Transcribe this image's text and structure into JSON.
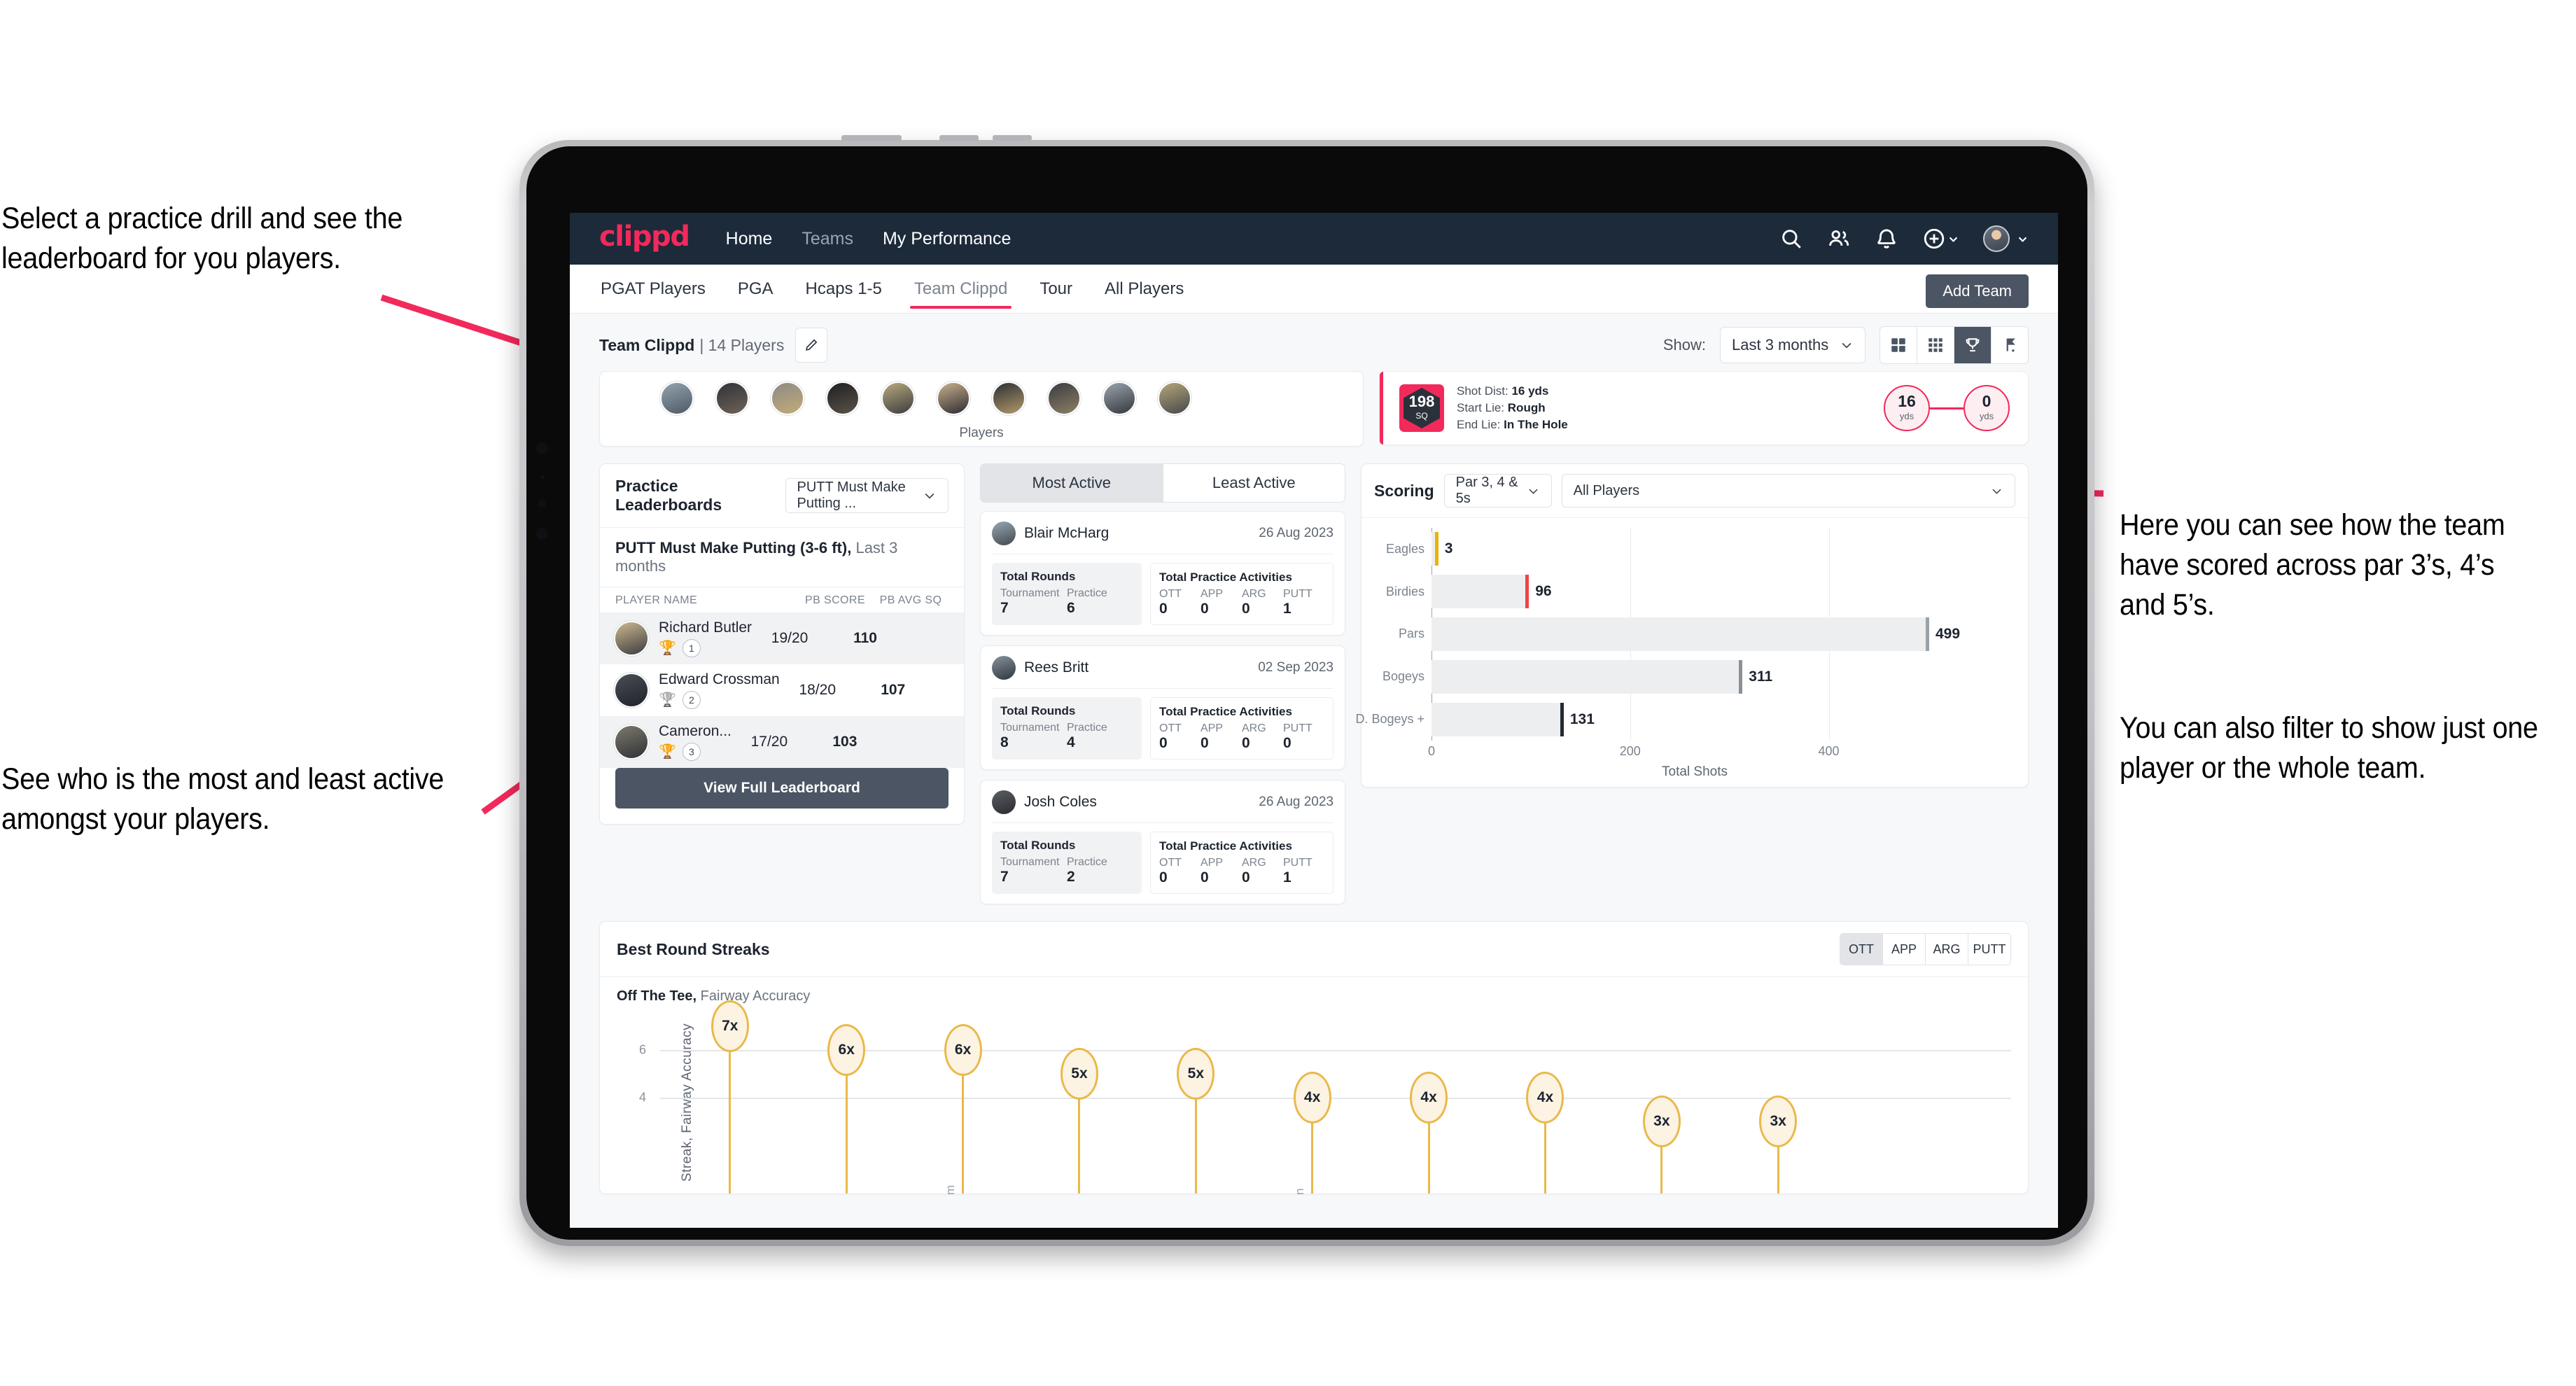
{
  "annotations": {
    "top_left": "Select a practice drill and see the leaderboard for you players.",
    "bottom_left": "See who is the most and least active amongst your players.",
    "right_1": "Here you can see how the team have scored across par 3’s, 4’s and 5’s.",
    "right_2": "You can also filter to show just one player or the whole team.",
    "accent_color": "#f2295b"
  },
  "navbar": {
    "logo": "clippd",
    "links": [
      {
        "label": "Home",
        "active": true
      },
      {
        "label": "Teams",
        "active": false
      },
      {
        "label": "My Performance",
        "active": true
      }
    ],
    "icons": [
      "search-icon",
      "people-icon",
      "bell-icon",
      "plus-circle-icon",
      "avatar"
    ],
    "brand_color": "#f2295b",
    "bg_color": "#1c2a3a"
  },
  "tabs": {
    "items": [
      "PGAT Players",
      "PGA",
      "Hcaps 1-5",
      "Team Clippd",
      "Tour",
      "All Players"
    ],
    "active": "Team Clippd",
    "add_team_label": "Add Team"
  },
  "team_header": {
    "team_name": "Team Clippd",
    "player_count_text": "| 14 Players",
    "edit_icon": "pencil-icon",
    "show_label": "Show:",
    "range_value": "Last 3 months",
    "view_modes": [
      "grid-large-icon",
      "grid-small-icon",
      "trophy-icon",
      "flag-icon"
    ],
    "view_mode_selected": "trophy-icon"
  },
  "players_strip": {
    "label": "Players",
    "avatar_count": 10
  },
  "shot_card": {
    "badge_value": "198",
    "badge_unit": "SQ",
    "lines": [
      {
        "label": "Shot Dist:",
        "value": "16 yds"
      },
      {
        "label": "Start Lie:",
        "value": "Rough"
      },
      {
        "label": "End Lie:",
        "value": "In The Hole"
      }
    ],
    "start_yards": "16",
    "start_unit": "yds",
    "end_yards": "0",
    "end_unit": "yds"
  },
  "leaderboard": {
    "title": "Practice Leaderboards",
    "drill_select": "PUTT Must Make Putting ...",
    "subtitle_bold": "PUTT Must Make Putting (3-6 ft),",
    "subtitle_muted": "Last 3 months",
    "columns": [
      "PLAYER NAME",
      "PB SCORE",
      "PB AVG SQ"
    ],
    "rows": [
      {
        "name": "Richard Butler",
        "rank": "1",
        "trophy": "🏆",
        "trophy_color": "#e8b63a",
        "score": "19/20",
        "avg_sq": "110"
      },
      {
        "name": "Edward Crossman",
        "rank": "2",
        "trophy": "🏆",
        "trophy_color": "#b8bcc1",
        "score": "18/20",
        "avg_sq": "107"
      },
      {
        "name": "Cameron...",
        "rank": "3",
        "trophy": "🏆",
        "trophy_color": "#cd8a4e",
        "score": "17/20",
        "avg_sq": "103"
      }
    ],
    "button_label": "View Full Leaderboard"
  },
  "activity": {
    "tabs": [
      "Most Active",
      "Least Active"
    ],
    "active_tab": "Most Active",
    "rounds_title": "Total Rounds",
    "practice_title": "Total Practice Activities",
    "rounds_keys": [
      "Tournament",
      "Practice"
    ],
    "practice_keys": [
      "OTT",
      "APP",
      "ARG",
      "PUTT"
    ],
    "cards": [
      {
        "name": "Blair McHarg",
        "date": "26 Aug 2023",
        "tournament": "7",
        "practice": "6",
        "ott": "0",
        "app": "0",
        "arg": "0",
        "putt": "1"
      },
      {
        "name": "Rees Britt",
        "date": "02 Sep 2023",
        "tournament": "8",
        "practice": "4",
        "ott": "0",
        "app": "0",
        "arg": "0",
        "putt": "0"
      },
      {
        "name": "Josh Coles",
        "date": "26 Aug 2023",
        "tournament": "7",
        "practice": "2",
        "ott": "0",
        "app": "0",
        "arg": "0",
        "putt": "1"
      }
    ]
  },
  "scoring": {
    "title": "Scoring",
    "par_select": "Par 3, 4 & 5s",
    "player_select": "All Players"
  },
  "streaks": {
    "title": "Best Round Streaks",
    "segments": [
      "OTT",
      "APP",
      "ARG",
      "PUTT"
    ],
    "segment_selected": "OTT",
    "subtitle_bold": "Off The Tee,",
    "subtitle_muted": "Fairway Accuracy"
  },
  "chart_data": [
    {
      "type": "bar",
      "orientation": "horizontal",
      "title": "Scoring",
      "categories": [
        "Eagles",
        "Birdies",
        "Pars",
        "Bogeys",
        "D. Bogeys +"
      ],
      "values": [
        3,
        96,
        499,
        311,
        131
      ],
      "cap_colors": [
        "#eab308",
        "#ef4444",
        "#9aa1a9",
        "#8b9097",
        "#232a33"
      ],
      "xlabel": "Total Shots",
      "ylabel": "",
      "xlim": [
        0,
        530
      ],
      "xticks": [
        0,
        200,
        400
      ],
      "grid": true,
      "legend": "none"
    },
    {
      "type": "bar",
      "orientation": "vertical",
      "title": "Best Round Streaks",
      "subtitle": "Off The Tee, Fairway Accuracy",
      "ylabel": "Streak, Fairway Accuracy",
      "xlabel": "",
      "ylim": [
        0,
        7.6
      ],
      "yticks": [
        4,
        6
      ],
      "grid": true,
      "categories": [
        "",
        "",
        "m",
        "",
        "",
        "n",
        "",
        "",
        "",
        ""
      ],
      "values": [
        7,
        6,
        6,
        5,
        5,
        4,
        4,
        4,
        3,
        3
      ],
      "labels": [
        "7x",
        "6x",
        "6x",
        "5x",
        "5x",
        "4x",
        "4x",
        "4x",
        "3x",
        "3x"
      ],
      "marker_color": "#e9b949",
      "marker_fill": "#fdf3e3"
    }
  ]
}
